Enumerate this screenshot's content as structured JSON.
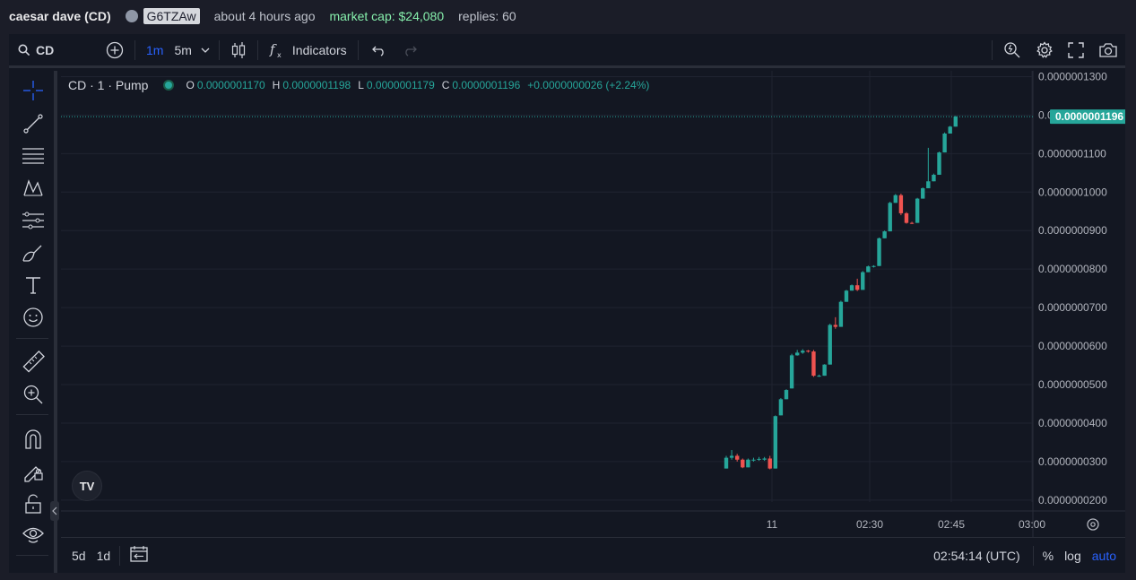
{
  "header": {
    "title": "caesar dave (CD)",
    "address": "G6TZAw",
    "time_ago": "about 4 hours ago",
    "market_cap": "market cap: $24,080",
    "replies": "replies: 60"
  },
  "toolbar": {
    "symbol": "CD",
    "interval_active": "1m",
    "interval_alt": "5m",
    "indicators_label": "Indicators"
  },
  "legend": {
    "symbol_label": "CD · 1 · Pump",
    "o_key": "O",
    "o_val": "0.0000001170",
    "h_key": "H",
    "h_val": "0.0000001198",
    "l_key": "L",
    "l_val": "0.0000001179",
    "c_key": "C",
    "c_val": "0.0000001196",
    "change": "+0.0000000026 (+2.24%)"
  },
  "logo_text": "TV",
  "bottombar": {
    "range_5d": "5d",
    "range_1d": "1d",
    "clock": "02:54:14 (UTC)",
    "percent": "%",
    "log": "log",
    "auto": "auto"
  },
  "chart_data": {
    "type": "candlestick",
    "y_tick_labels": [
      "0.0000001300",
      "0.0000001200",
      "0.0000001100",
      "0.0000001000",
      "0.0000000900",
      "0.0000000800",
      "0.0000000700",
      "0.0000000600",
      "0.0000000500",
      "0.0000000400",
      "0.0000000300",
      "0.0000000200"
    ],
    "y_ticks": [
      130,
      120,
      110,
      100,
      90,
      80,
      70,
      60,
      50,
      40,
      30,
      20
    ],
    "ylim": [
      19.5,
      131.5
    ],
    "x_tick_labels": [
      "11",
      "02:30",
      "02:45",
      "03:00"
    ],
    "last_price_label": "0.0000001196",
    "last_price": 119.6,
    "grid": true,
    "value_unit_note": "0.0000000001",
    "candles": [
      {
        "o": 28.2,
        "h": 31.5,
        "l": 28.2,
        "c": 31.0
      },
      {
        "o": 31.0,
        "h": 33.0,
        "l": 30.5,
        "c": 31.5
      },
      {
        "o": 31.5,
        "h": 32.0,
        "l": 30.0,
        "c": 30.5
      },
      {
        "o": 30.5,
        "h": 30.8,
        "l": 28.3,
        "c": 28.5
      },
      {
        "o": 28.5,
        "h": 30.8,
        "l": 28.5,
        "c": 30.5
      },
      {
        "o": 30.5,
        "h": 31.0,
        "l": 30.0,
        "c": 30.5
      },
      {
        "o": 30.5,
        "h": 31.2,
        "l": 30.2,
        "c": 30.7
      },
      {
        "o": 30.5,
        "h": 31.2,
        "l": 30.2,
        "c": 30.8
      },
      {
        "o": 30.8,
        "h": 31.5,
        "l": 28.0,
        "c": 28.2
      },
      {
        "o": 28.2,
        "h": 42.0,
        "l": 28.2,
        "c": 41.8
      },
      {
        "o": 42.0,
        "h": 46.5,
        "l": 42.0,
        "c": 46.2
      },
      {
        "o": 46.2,
        "h": 48.8,
        "l": 46.2,
        "c": 48.6
      },
      {
        "o": 49.0,
        "h": 58.0,
        "l": 49.0,
        "c": 57.6
      },
      {
        "o": 57.6,
        "h": 59.0,
        "l": 57.5,
        "c": 58.3
      },
      {
        "o": 58.3,
        "h": 59.2,
        "l": 58.0,
        "c": 58.8
      },
      {
        "o": 58.8,
        "h": 59.0,
        "l": 58.3,
        "c": 58.6
      },
      {
        "o": 58.6,
        "h": 59.0,
        "l": 52.0,
        "c": 52.3
      },
      {
        "o": 52.3,
        "h": 52.6,
        "l": 52.0,
        "c": 52.3
      },
      {
        "o": 52.3,
        "h": 55.3,
        "l": 52.3,
        "c": 55.2
      },
      {
        "o": 55.2,
        "h": 65.8,
        "l": 55.2,
        "c": 65.5
      },
      {
        "o": 65.5,
        "h": 67.5,
        "l": 64.5,
        "c": 65.0
      },
      {
        "o": 65.0,
        "h": 71.8,
        "l": 65.0,
        "c": 71.5
      },
      {
        "o": 71.5,
        "h": 74.6,
        "l": 71.5,
        "c": 74.4
      },
      {
        "o": 74.4,
        "h": 76.0,
        "l": 74.4,
        "c": 75.8
      },
      {
        "o": 75.8,
        "h": 77.5,
        "l": 74.3,
        "c": 74.6
      },
      {
        "o": 74.6,
        "h": 79.5,
        "l": 74.6,
        "c": 79.2
      },
      {
        "o": 79.2,
        "h": 80.9,
        "l": 79.2,
        "c": 80.7
      },
      {
        "o": 80.7,
        "h": 81.0,
        "l": 80.4,
        "c": 80.8
      },
      {
        "o": 80.8,
        "h": 88.2,
        "l": 80.8,
        "c": 88.0
      },
      {
        "o": 88.0,
        "h": 90.0,
        "l": 88.0,
        "c": 89.8
      },
      {
        "o": 89.8,
        "h": 97.5,
        "l": 89.8,
        "c": 97.2
      },
      {
        "o": 97.2,
        "h": 99.5,
        "l": 97.2,
        "c": 99.2
      },
      {
        "o": 99.2,
        "h": 99.6,
        "l": 94.0,
        "c": 94.5
      },
      {
        "o": 94.5,
        "h": 94.8,
        "l": 91.8,
        "c": 92.0
      },
      {
        "o": 92.0,
        "h": 92.3,
        "l": 91.7,
        "c": 91.8
      },
      {
        "o": 92.0,
        "h": 98.5,
        "l": 92.0,
        "c": 98.3
      },
      {
        "o": 98.3,
        "h": 101.2,
        "l": 98.3,
        "c": 101.0
      },
      {
        "o": 101.0,
        "h": 111.5,
        "l": 102.5,
        "c": 102.8
      },
      {
        "o": 102.8,
        "h": 104.8,
        "l": 102.8,
        "c": 104.5
      },
      {
        "o": 104.5,
        "h": 110.5,
        "l": 104.5,
        "c": 110.3
      },
      {
        "o": 110.3,
        "h": 115.5,
        "l": 110.3,
        "c": 115.2
      },
      {
        "o": 115.2,
        "h": 117.2,
        "l": 115.2,
        "c": 117.0
      },
      {
        "o": 117.0,
        "h": 119.8,
        "l": 117.0,
        "c": 119.6
      }
    ]
  },
  "colors": {
    "up": "#26a69a",
    "down": "#ef5350",
    "accent": "#2962ff",
    "background": "#131722",
    "grid": "#1f2330"
  },
  "icons": {
    "leftbar": [
      "crosshair-icon",
      "trend-line-icon",
      "fib-retracement-icon",
      "pattern-icon",
      "prediction-icon",
      "brush-icon",
      "text-icon",
      "emoji-icon",
      "ruler-icon",
      "zoom-in-icon",
      "magnet-icon",
      "lock-drawings-icon",
      "lock-icon",
      "eye-icon"
    ]
  }
}
